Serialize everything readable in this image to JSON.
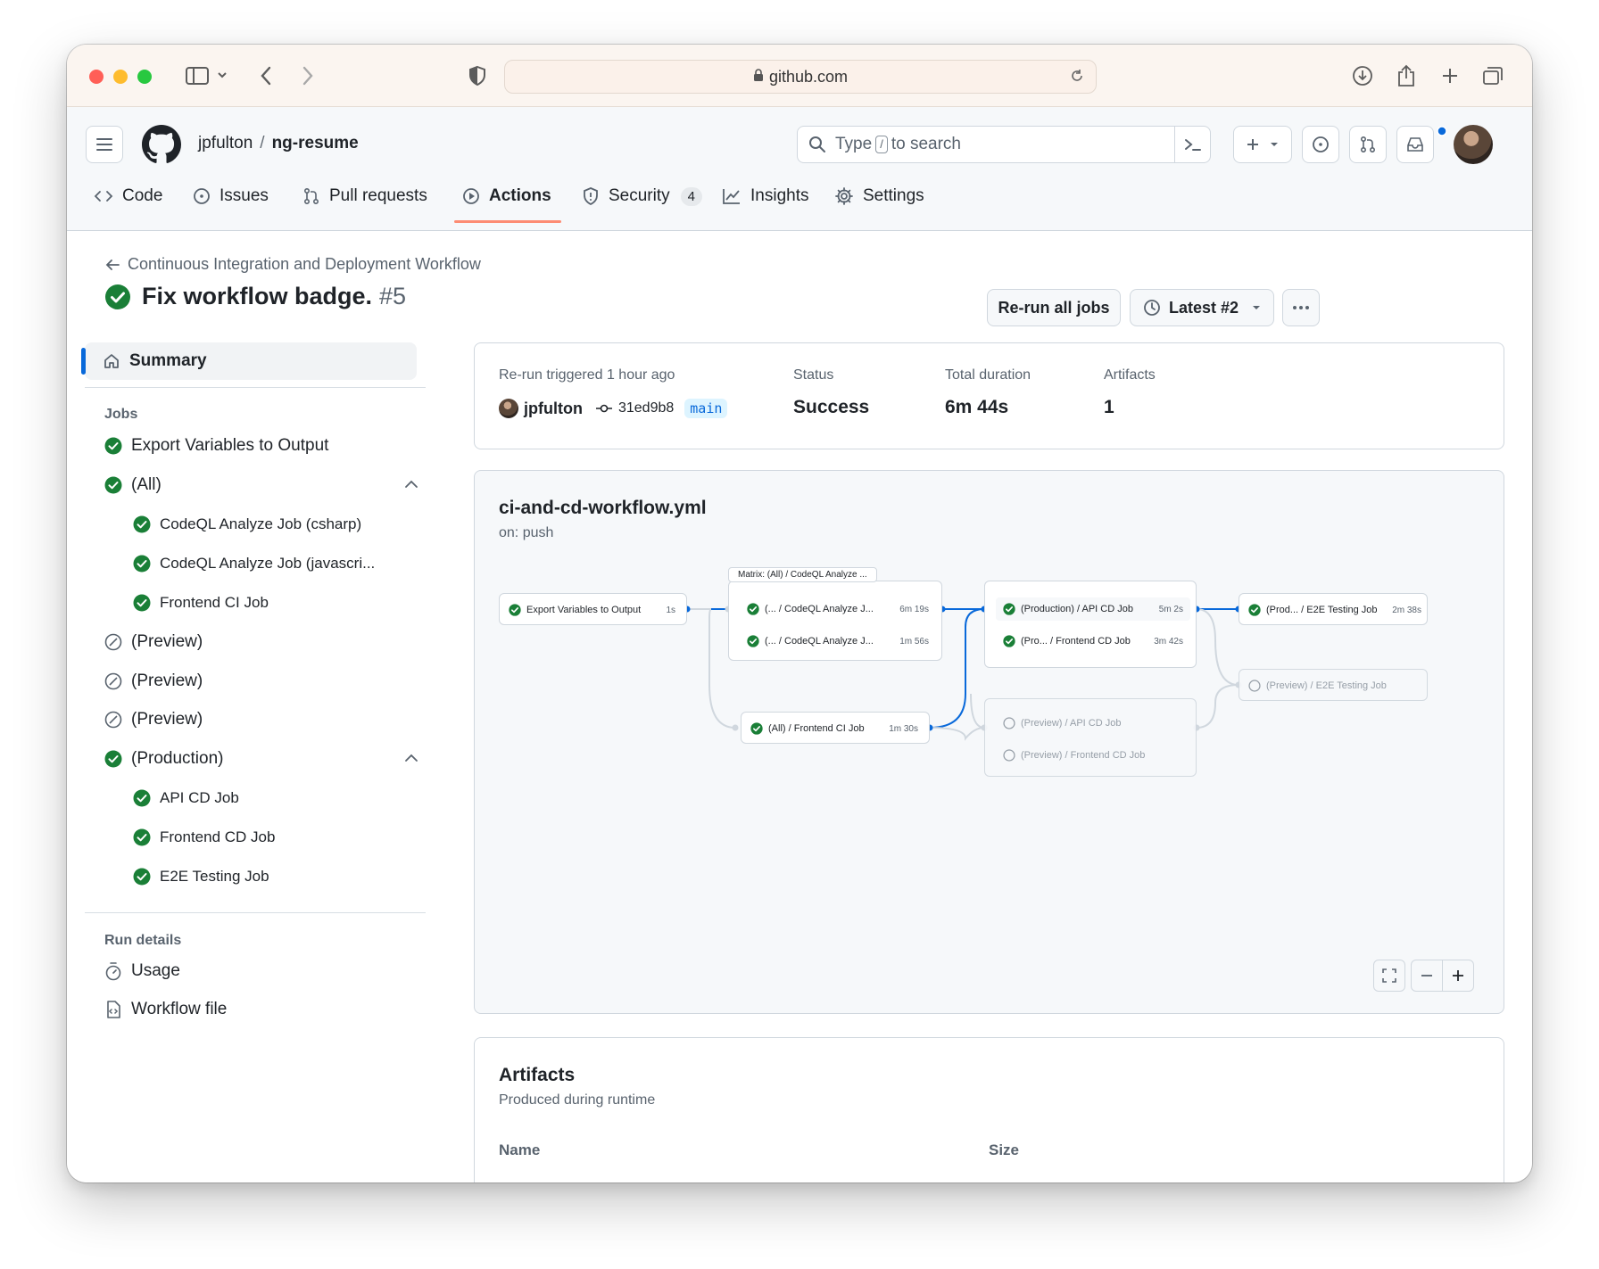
{
  "browser": {
    "url": "github.com"
  },
  "header": {
    "owner": "jpfulton",
    "separator": "/",
    "repo": "ng-resume",
    "search_prefix": "Type",
    "search_key": "/",
    "search_suffix": "to search"
  },
  "tabs": [
    {
      "label": "Code"
    },
    {
      "label": "Issues"
    },
    {
      "label": "Pull requests"
    },
    {
      "label": "Actions"
    },
    {
      "label": "Security",
      "count": "4"
    },
    {
      "label": "Insights"
    },
    {
      "label": "Settings"
    }
  ],
  "run": {
    "workflow_name": "Continuous Integration and Deployment Workflow",
    "title": "Fix workflow badge.",
    "number": "#5",
    "rerun_label": "Re-run all jobs",
    "attempt_label": "Latest #2"
  },
  "sidebar": {
    "summary": "Summary",
    "jobs_heading": "Jobs",
    "jobs": [
      {
        "label": "Export Variables to Output"
      },
      {
        "label": "(All)"
      },
      {
        "label": "CodeQL Analyze Job (csharp)"
      },
      {
        "label": "CodeQL Analyze Job (javascri..."
      },
      {
        "label": "Frontend CI Job"
      },
      {
        "label": "(Preview)"
      },
      {
        "label": "(Preview)"
      },
      {
        "label": "(Preview)"
      },
      {
        "label": "(Production)"
      },
      {
        "label": "API CD Job"
      },
      {
        "label": "Frontend CD Job"
      },
      {
        "label": "E2E Testing Job"
      }
    ],
    "run_details_heading": "Run details",
    "usage": "Usage",
    "workflow_file": "Workflow file"
  },
  "summary": {
    "trigger_label": "Re-run triggered 1 hour ago",
    "actor": "jpfulton",
    "commit": "31ed9b8",
    "branch": "main",
    "status_label": "Status",
    "status_value": "Success",
    "duration_label": "Total duration",
    "duration_value": "6m 44s",
    "artifacts_label": "Artifacts",
    "artifacts_value": "1"
  },
  "workflow_graph": {
    "file": "ci-and-cd-workflow.yml",
    "trigger": "on: push",
    "export_job": {
      "label": "Export Variables to Output",
      "duration": "1s"
    },
    "matrix_label": "Matrix: (All) / CodeQL Analyze ...",
    "codeql_jobs": [
      {
        "label": "(... / CodeQL Analyze J...",
        "duration": "6m 19s"
      },
      {
        "label": "(... / CodeQL Analyze J...",
        "duration": "1m 56s"
      }
    ],
    "frontend_ci": {
      "label": "(All) / Frontend CI Job",
      "duration": "1m 30s"
    },
    "production_jobs": [
      {
        "label": "(Production) / API CD Job",
        "duration": "5m 2s"
      },
      {
        "label": "(Pro... / Frontend CD Job",
        "duration": "3m 42s"
      }
    ],
    "preview_jobs": [
      {
        "label": "(Preview) / API CD Job"
      },
      {
        "label": "(Preview) / Frontend CD Job"
      }
    ],
    "e2e_prod": {
      "label": "(Prod... / E2E Testing Job",
      "duration": "2m 38s"
    },
    "e2e_preview": {
      "label": "(Preview) / E2E Testing Job"
    }
  },
  "artifacts": {
    "title": "Artifacts",
    "subtitle": "Produced during runtime",
    "col_name": "Name",
    "col_size": "Size"
  },
  "colors": {
    "success": "#1a7f37",
    "accent": "#0969da",
    "tab_underline": "#fd8c73"
  }
}
